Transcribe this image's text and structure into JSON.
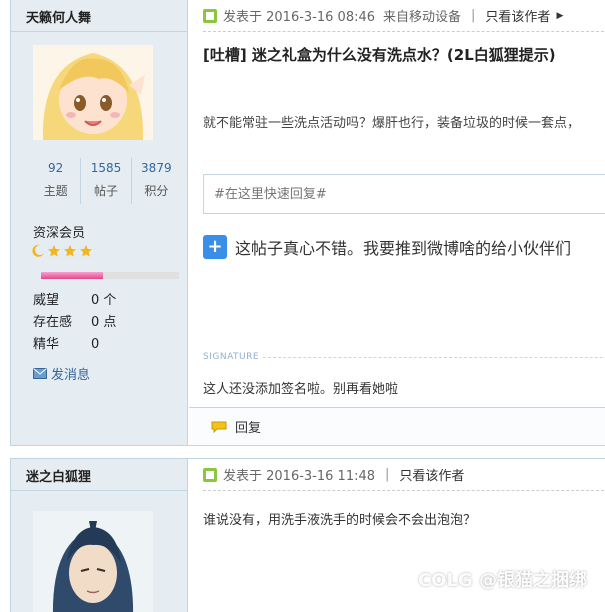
{
  "post1": {
    "author": "天籁何人舞",
    "stats": [
      {
        "num": "92",
        "label": "主题"
      },
      {
        "num": "1585",
        "label": "帖子"
      },
      {
        "num": "3879",
        "label": "积分"
      }
    ],
    "rank": "资深会员",
    "level_progress": 0.45,
    "props": [
      {
        "k": "威望",
        "v": "0 个"
      },
      {
        "k": "存在感",
        "v": "0 点"
      },
      {
        "k": "精华",
        "v": "0"
      }
    ],
    "pm_label": "发消息",
    "posted_at": "发表于 2016-3-16 08:46",
    "source": "来自移动设备",
    "only_author": "只看该作者",
    "title": "[吐槽] 迷之礼盒为什么没有洗点水？(2L白狐狸提示)",
    "content": "就不能常驻一些洗点活动吗？爆肝也行，装备垃圾的时候一套点，",
    "quick_reply_placeholder": "#在这里快速回复#",
    "share_text": "这帖子真心不错。我要推到微博啥的给小伙伴们",
    "signature_label": "SIGNATURE",
    "signature": "这人还没添加签名啦。别再看她啦",
    "reply_label": "回复"
  },
  "post2": {
    "author": "迷之白狐狸",
    "posted_at": "发表于 2016-3-16 11:48",
    "only_author": "只看该作者",
    "content": "谁说没有，用洗手液洗手的时候会不会出泡泡？"
  },
  "watermark": "COLG @银猫之捆绑",
  "colors": {
    "sidebar_bg": "#e5edf2",
    "border": "#c2d5e3",
    "link": "#336699",
    "progress": "#e0488f"
  }
}
